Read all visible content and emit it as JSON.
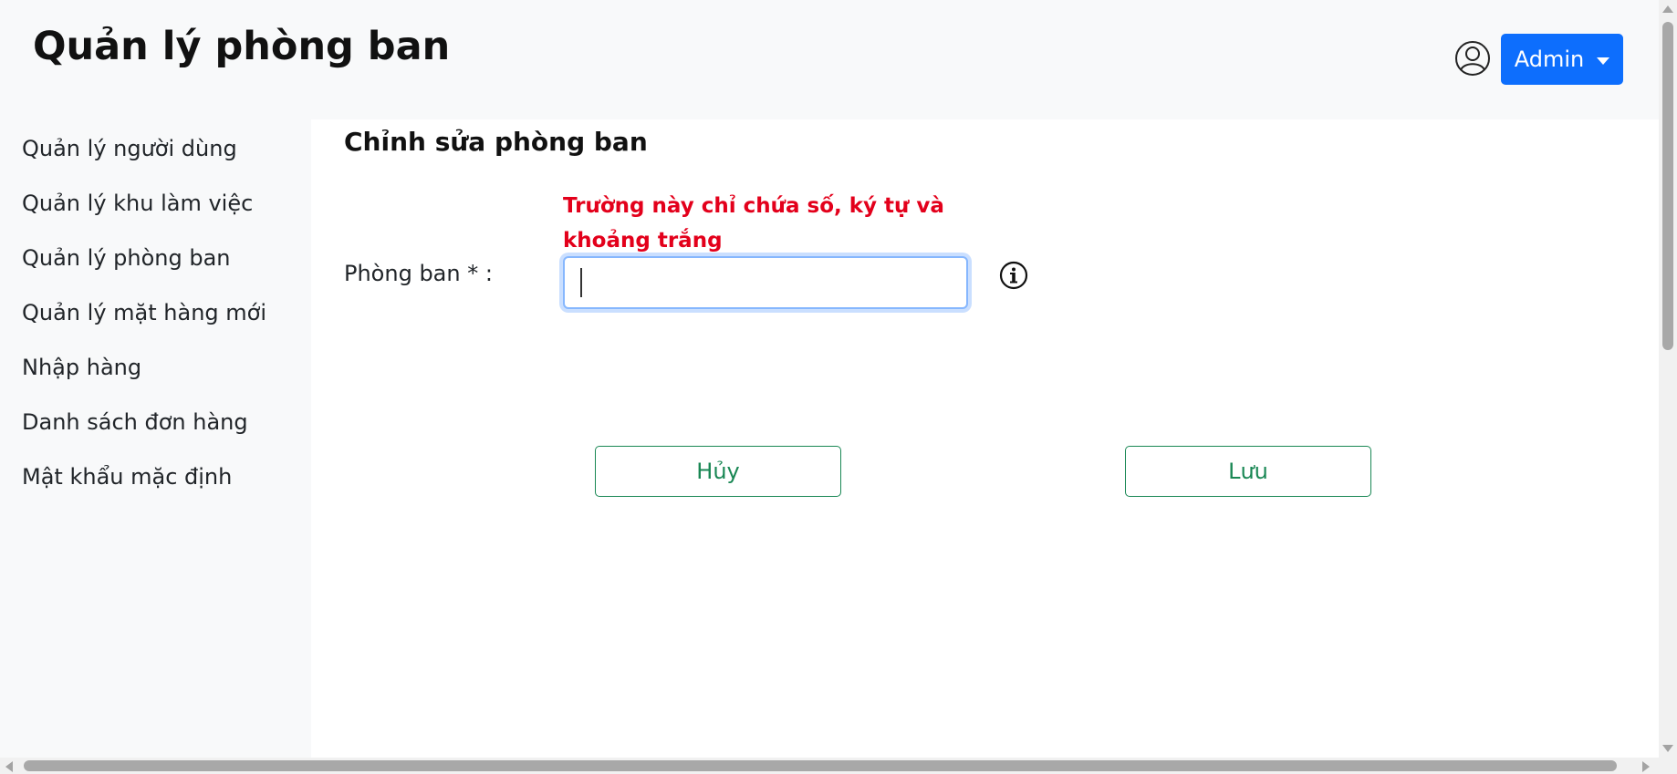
{
  "header": {
    "title": "Quản lý phòng ban",
    "user_menu_label": "Admin",
    "user_icon": "user-circle-icon",
    "accent_color": "#0d6efd"
  },
  "sidebar": {
    "items": [
      {
        "label": "Quản lý người dùng"
      },
      {
        "label": "Quản lý khu làm việc"
      },
      {
        "label": "Quản lý phòng ban"
      },
      {
        "label": "Quản lý mặt hàng mới"
      },
      {
        "label": "Nhập hàng"
      },
      {
        "label": "Danh sách đơn hàng"
      },
      {
        "label": "Mật khẩu mặc định"
      }
    ]
  },
  "form": {
    "section_title": "Chỉnh sửa phòng ban",
    "error_message": "Trường này chỉ chứa số, ký tự và khoảng trắng",
    "error_color": "#e3001b",
    "field_label": "Phòng ban * :",
    "field_value": "",
    "info_icon": "info-circle-icon",
    "cancel_label": "Hủy",
    "save_label": "Lưu",
    "button_color": "#198754"
  }
}
